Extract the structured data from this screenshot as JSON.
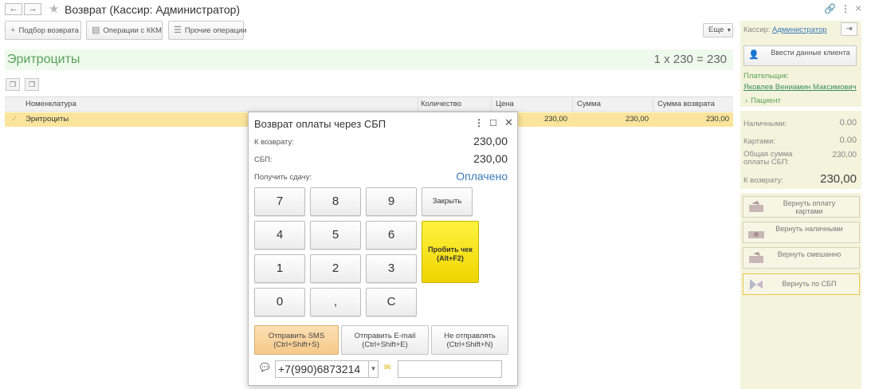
{
  "window": {
    "title": "Возврат (Кассир: Администратор)",
    "back_icon": "←",
    "forward_icon": "→",
    "star_icon": "★",
    "link_icon": "🔗",
    "menu_icon": "⋮",
    "close_icon": "×"
  },
  "toolbar": {
    "selection_label": "Подбор возврата",
    "kkm_label": "Операции с ККМ",
    "other_label": "Прочие операции",
    "more_label": "Еще"
  },
  "product": {
    "name": "Эритроциты",
    "calc": "1 x 230 = 230"
  },
  "table": {
    "columns": [
      "Номенклатура",
      "Количество",
      "Цена",
      "Сумма",
      "Сумма возврата"
    ],
    "rows": [
      {
        "name": "Эритроциты",
        "price": "230,00",
        "sum": "230,00",
        "return_sum": "230,00"
      }
    ]
  },
  "right_panel": {
    "cashier_label": "Кассир:",
    "cashier_name": "Администратор",
    "client_button": "Ввести данные клиента",
    "payer_label": "Плательщик:",
    "payer_name": "Яковлев Вениамин Максимович",
    "patient_label": "Пациент",
    "cash_label": "Наличными:",
    "cash_value": "0.00",
    "card_label": "Картами:",
    "card_value": "0.00",
    "total_label": "Общая сумма оплаты СБП:",
    "total_value": "230,00",
    "refund_label": "К возврату:",
    "refund_value": "230,00",
    "btn_card": "Вернуть оплату картами",
    "btn_cash": "Вернуть наличными",
    "btn_mixed": "Вернуть смешанно",
    "btn_sbp": "Вернуть по СБП"
  },
  "modal": {
    "title": "Возврат оплаты через СБП",
    "refund_label": "К возврату:",
    "refund_value": "230,00",
    "sbp_label": "СБП:",
    "sbp_value": "230,00",
    "change_label": "Получить сдачу:",
    "change_value": "Оплачено",
    "keys": [
      "7",
      "8",
      "9",
      "4",
      "5",
      "6",
      "1",
      "2",
      "3",
      "0",
      ",",
      "C"
    ],
    "close_key": "Закрыть",
    "print_key": "Пробить чек (Alt+F2)",
    "send_sms": "Отправить SMS (Ctrl+Shift+S)",
    "send_email": "Отправить E-mail (Ctrl+Shift+E)",
    "no_send": "Не отправлять (Ctrl+Shift+N)",
    "phone": "+7(990)6873214",
    "email": ""
  },
  "colors": {
    "accent_yellow": "#f2d800",
    "row_highlight": "#fbe59c",
    "panel_bg": "#f4f3dc",
    "link_blue": "#3b7ab8",
    "green_text": "#5aa15a"
  }
}
